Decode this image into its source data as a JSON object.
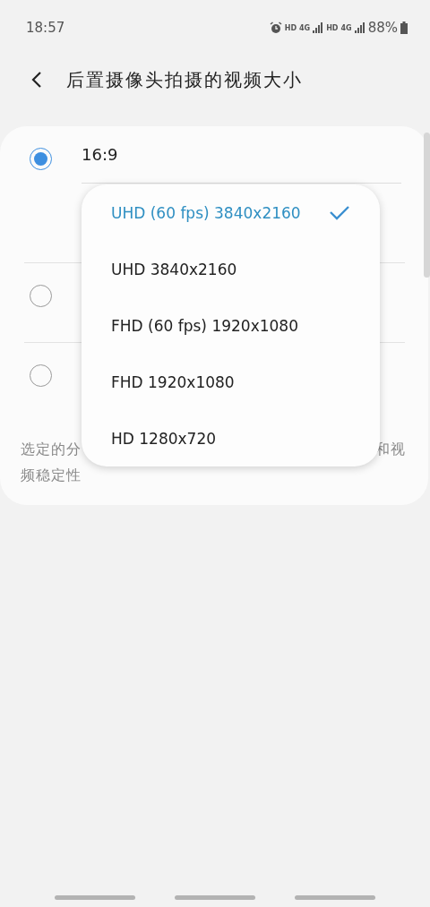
{
  "status_bar": {
    "time": "18:57",
    "sim1_hd": "HD",
    "sim1_net": "4G",
    "sim2_hd": "HD",
    "sim2_net": "4G",
    "battery": "88%"
  },
  "header": {
    "title": "后置摄像头拍摄的视频大小"
  },
  "options": [
    {
      "label": "16:9",
      "selected": true
    },
    {
      "selected": false
    },
    {
      "selected": false
    }
  ],
  "description": {
    "start": "选定的分",
    "end": "和视",
    "line_2": "频稳定性"
  },
  "dropdown": [
    {
      "label": "UHD (60 fps) 3840x2160",
      "selected": true
    },
    {
      "label": "UHD 3840x2160",
      "selected": false
    },
    {
      "label": "FHD (60 fps) 1920x1080",
      "selected": false
    },
    {
      "label": "FHD 1920x1080",
      "selected": false
    },
    {
      "label": "HD 1280x720",
      "selected": false
    }
  ]
}
